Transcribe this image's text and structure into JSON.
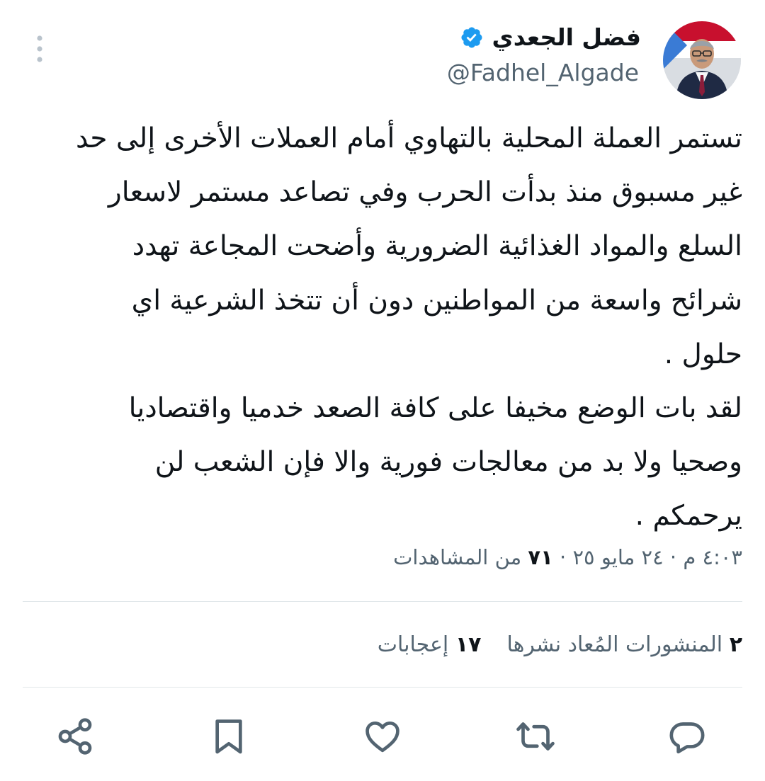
{
  "author": {
    "display_name": "فضل الجعدي",
    "handle": "@Fadhel_Algade",
    "verified": true
  },
  "tweet": {
    "text": "تستمر العملة المحلية بالتهاوي أمام العملات الأخرى إلى حد\nغير مسبوق منذ بدأت الحرب وفي تصاعد مستمر لاسعار\nالسلع والمواد الغذائية الضرورية وأضحت المجاعة تهدد\nشرائح واسعة من المواطنين دون أن تتخذ الشرعية اي\nحلول .\nلقد بات الوضع مخيفا على كافة الصعد خدميا واقتصاديا\nوصحيا ولا بد من معالجات فورية والا فإن الشعب لن\nيرحمكم ."
  },
  "meta": {
    "time": "٤:٠٣ م",
    "separator": "·",
    "date": "٢٤ مايو ٢٥",
    "views_count": "٧١",
    "views_label": "من المشاهدات"
  },
  "stats": {
    "reposts_count": "٢",
    "reposts_label": "المنشورات المُعاد نشرها",
    "likes_count": "١٧",
    "likes_label": "إعجابات"
  },
  "actions": {
    "icons": [
      "reply-icon",
      "repost-icon",
      "like-icon",
      "bookmark-icon",
      "share-icon"
    ]
  },
  "colors": {
    "text": "#0f1419",
    "secondary": "#536471",
    "icon": "#536471",
    "verified": "#1d9bf0",
    "divider": "#e1e7ea"
  }
}
